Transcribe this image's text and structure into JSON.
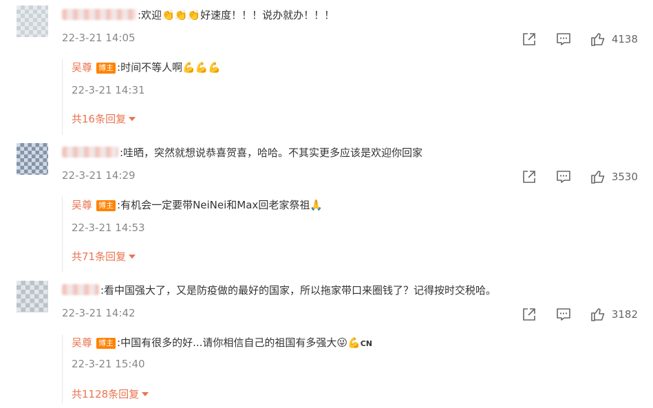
{
  "comments": [
    {
      "text": ":欢迎👏👏👏好速度！！！说办就办！！！",
      "time": "22-3-21 14:05",
      "likes": "4138",
      "reply": {
        "author": "吴尊",
        "badge": "博主",
        "text": ":时间不等人啊💪💪💪",
        "time": "22-3-21 14:31"
      },
      "more": "共16条回复"
    },
    {
      "text": ":哇晒，突然就想说恭喜贺喜，哈哈。不其实更多应该是欢迎你回家",
      "time": "22-3-21 14:29",
      "likes": "3530",
      "reply": {
        "author": "吴尊",
        "badge": "博主",
        "text": ":有机会一定要带NeiNei和Max回老家祭祖🙏",
        "time": "22-3-21 14:53"
      },
      "more": "共71条回复"
    },
    {
      "text": ":看中国强大了，又是防疫做的最好的国家，所以拖家带口来圈钱了？记得按时交税哈。",
      "time": "22-3-21 14:42",
      "likes": "3182",
      "reply": {
        "author": "吴尊",
        "badge": "博主",
        "text": ":中国有很多的好...请你相信自己的祖国有多强大😜💪",
        "cn": "CN",
        "time": "22-3-21 15:40"
      },
      "more": "共1128条回复"
    }
  ],
  "icons": {
    "share": "share-icon",
    "comment": "comment-icon",
    "like": "thumbs-up-icon"
  },
  "colors": {
    "author": "#eb7350",
    "badge": "#ff8200",
    "time": "#888888"
  }
}
